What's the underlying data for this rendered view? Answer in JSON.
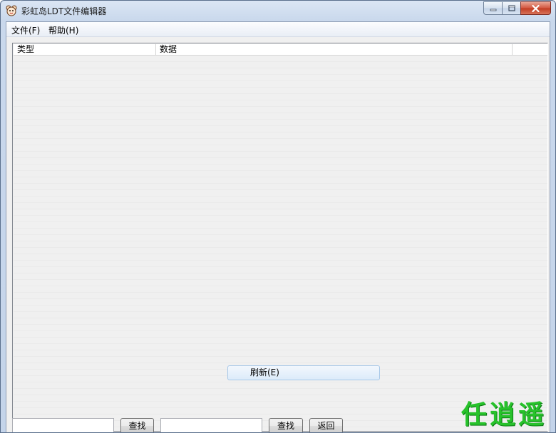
{
  "window": {
    "title": "彩虹岛LDT文件编辑器",
    "icon": "cartoon-face-icon"
  },
  "menu": {
    "items": [
      {
        "label": "文件(F)"
      },
      {
        "label": "帮助(H)"
      }
    ]
  },
  "list": {
    "columns": [
      {
        "label": "类型"
      },
      {
        "label": "数据"
      },
      {
        "label": ""
      }
    ],
    "context_item": {
      "label": "刷新(E)"
    }
  },
  "toolbar": {
    "search1": {
      "value": "",
      "placeholder": ""
    },
    "find1_label": "查找",
    "search2": {
      "value": "",
      "placeholder": ""
    },
    "find2_label": "查找",
    "back_label": "返回"
  },
  "watermark": "任逍遥",
  "colors": {
    "watermark": "#27c22b",
    "close_button": "#c13c22",
    "title_bar": "#c9d8ec"
  }
}
